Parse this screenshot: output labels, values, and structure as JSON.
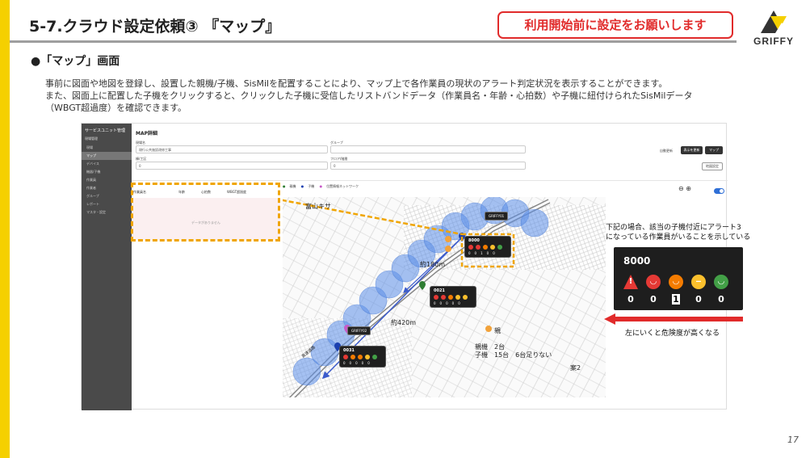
{
  "slide": {
    "title": "5-7.クラウド設定依頼③ 『マップ』",
    "notice": "利用開始前に設定をお願いします",
    "logo_text": "GRIFFY",
    "section_heading": "●「マップ」画面",
    "description": [
      "事前に図面や地図を登録し、設置した親機/子機、SisMilを配置することにより、マップ上で各作業員の現状のアラート判定状況を表示することができます。",
      "また、図面上に配置した子機をクリックすると、クリックした子機に受信したリストバンドデータ（作業員名・年齢・心拍数）や子機に紐付けられたSisMilデータ",
      "（WBGT超過度）を確認できます。"
    ],
    "page_number": "17"
  },
  "app": {
    "sidebar": {
      "title": "サービスユニット管理",
      "subtitle": "現場管理",
      "items": [
        {
          "label": "現場",
          "icon": "home-icon"
        },
        {
          "label": "マップ",
          "icon": "map-icon"
        },
        {
          "label": "デバイス",
          "icon": "device-icon"
        },
        {
          "label": "機器/子機",
          "icon": "node-icon"
        },
        {
          "label": "作業員",
          "icon": "user-icon"
        },
        {
          "label": "作業者",
          "icon": "worker-icon"
        },
        {
          "label": "グループ",
          "icon": "group-icon"
        },
        {
          "label": "レポート",
          "icon": "report-icon"
        },
        {
          "label": "マスタ・設定",
          "icon": "settings-icon"
        }
      ],
      "active_index": 1
    },
    "form": {
      "title": "MAP詳細",
      "site_label": "現場名",
      "site_value": "現行公共施設改修工事",
      "group_label": "グループ",
      "group_value": "",
      "building_label": "棟/工区",
      "building_value": "0",
      "floor_label": "フロア/階層",
      "floor_value": "0",
      "auto_refresh_label": "自動更新",
      "update_button": "表示を更新",
      "map_button": "マップ",
      "fit_button": "地図設定"
    },
    "table": {
      "headers": [
        "作業員名",
        "年齢",
        "心拍数",
        "WBGT超過度"
      ],
      "empty_text": "データがありません"
    },
    "map_legend": [
      "親機",
      "子機",
      "位置情報ネットワーク"
    ],
    "toggle_label": "子機を表示",
    "map": {
      "area_label": "富山キサ",
      "popups": [
        {
          "id": "8000",
          "counts": [
            "0",
            "0",
            "1",
            "0",
            "0"
          ]
        },
        {
          "id": "0021",
          "counts": [
            "0",
            "0",
            "0",
            "0",
            "0"
          ]
        },
        {
          "id": "0031",
          "counts": [
            "0",
            "0",
            "0",
            "0",
            "0"
          ]
        }
      ],
      "tags": [
        "GRIFFY01",
        "GRIFFY02"
      ],
      "distance_1": "約180m",
      "distance_2": "約420m",
      "legend_parent": "親",
      "count_parent": "親機　2台",
      "count_child": "子機　15台　6台足りない",
      "plan_label": "案2",
      "road_label": "高速道路"
    }
  },
  "annotation": {
    "note_line1": "下記の場合、該当の子機付近にアラート3",
    "note_line2": "になっている作業員がいることを示している",
    "card_id": "8000",
    "card_counts": [
      "0",
      "0",
      "1",
      "0",
      "0"
    ],
    "arrow_text": "左にいくと危険度が高くなる"
  },
  "colors": {
    "accent_yellow": "#f5d000",
    "alert_red": "#e12b2b",
    "dash_orange": "#f0a500",
    "level_red": "#e53935",
    "level_orange": "#f57c00",
    "level_yellow": "#fbc02d",
    "level_green": "#43a047"
  }
}
